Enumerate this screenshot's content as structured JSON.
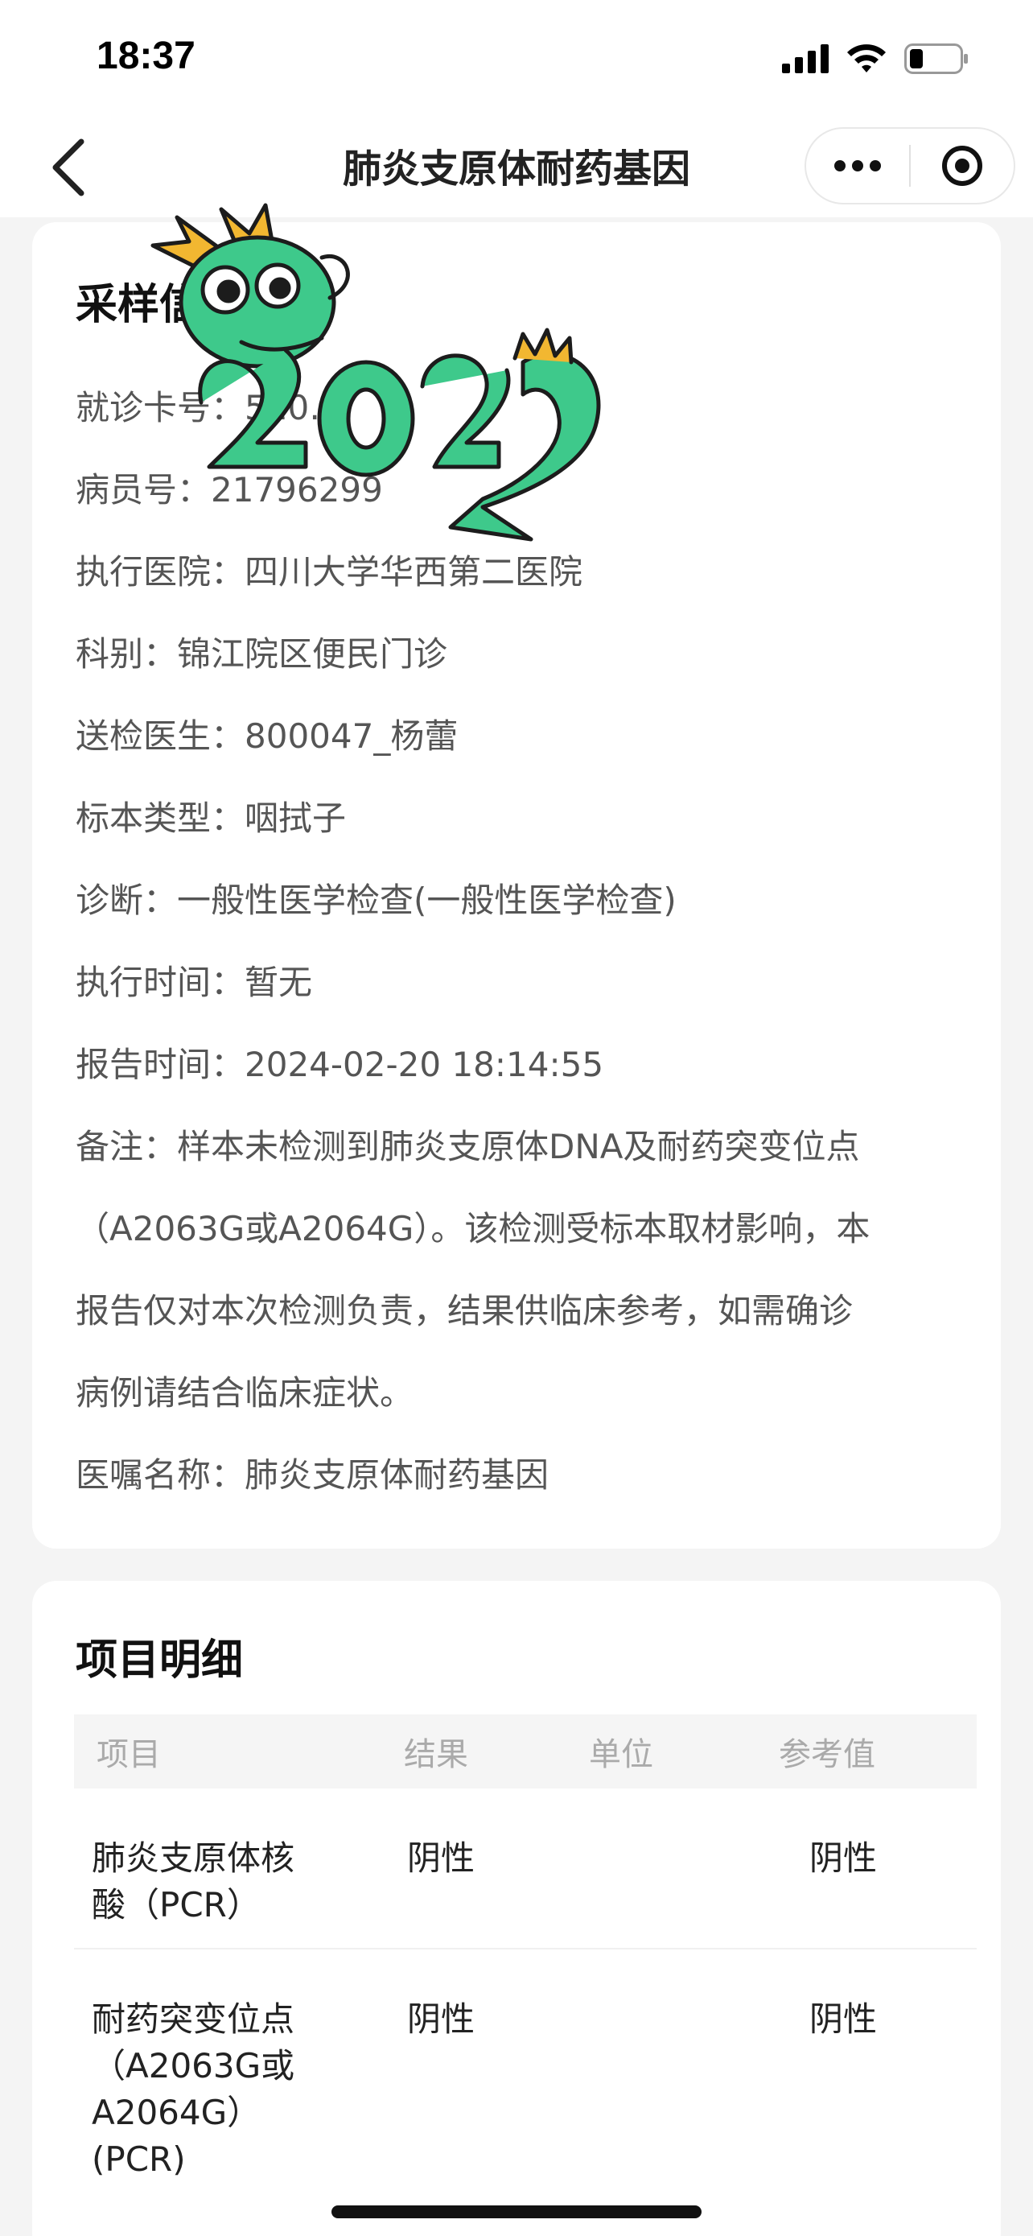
{
  "status_bar": {
    "time": "18:37",
    "icons": [
      "signal-icon",
      "wifi-icon",
      "battery-icon"
    ]
  },
  "nav": {
    "title": "肺炎支原体耐药基因",
    "back_icon": "chevron-left-icon",
    "more_icon": "more-dots-icon",
    "close_icon": "target-close-icon"
  },
  "info_card": {
    "title": "采样信息",
    "rows": [
      {
        "label": "就诊卡号：",
        "value": "510…96"
      },
      {
        "label": "病员号：",
        "value": "21796299"
      },
      {
        "label": "执行医院：",
        "value": "四川大学华西第二医院"
      },
      {
        "label": "科别：",
        "value": "锦江院区便民门诊"
      },
      {
        "label": "送检医生：",
        "value": "800047_杨蕾"
      },
      {
        "label": "标本类型：",
        "value": "咽拭子"
      },
      {
        "label": "诊断：",
        "value": "一般性医学检查(一般性医学检查)"
      },
      {
        "label": "执行时间：",
        "value": "暂无"
      },
      {
        "label": "报告时间：",
        "value": "2024-02-20 18:14:55"
      }
    ],
    "note_lines": [
      "备注：样本未检测到肺炎支原体DNA及耐药突变位点",
      "（A2063G或A2064G）。该检测受标本取材影响，本",
      "报告仅对本次检测负责，结果供临床参考，如需确诊",
      "病例请结合临床症状。"
    ],
    "order_label": "医嘱名称：",
    "order_value": "肺炎支原体耐药基因"
  },
  "items_card": {
    "title": "项目明细",
    "headers": {
      "item": "项目",
      "result": "结果",
      "unit": "单位",
      "ref": "参考值"
    },
    "rows": [
      {
        "item_lines": [
          "肺炎支原体核",
          "酸（PCR）"
        ],
        "result": "阴性",
        "unit": "",
        "ref": "阴性"
      },
      {
        "item_lines": [
          "耐药突变位点",
          "（A2063G或",
          "A2064G）",
          "(PCR)"
        ],
        "result": "阴性",
        "unit": "",
        "ref": "阴性"
      }
    ]
  },
  "colors": {
    "background": "#f4f4f4",
    "card": "#ffffff",
    "text_primary": "#222222",
    "text_secondary": "#555555",
    "header_gray": "#aaaaaa",
    "sticker_green": "#3ec98b"
  },
  "overlay": {
    "sticker": "dragon-2024-sticker"
  }
}
